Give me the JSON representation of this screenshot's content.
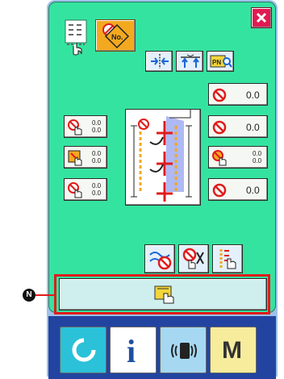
{
  "top": {
    "close_icon": "close-x-icon",
    "pattern_icon": "pattern-list-icon",
    "no_icon_label": "No.",
    "pn_label": "PN"
  },
  "values": {
    "r1": "0.0",
    "r2": "0.0",
    "r3": "0.0",
    "r4": "0.0"
  },
  "left_stacks": {
    "l1": [
      "0.0",
      "0.0"
    ],
    "l2": [
      "0.0",
      "0.0"
    ],
    "l3": [
      "0.0",
      "0.0"
    ],
    "mid3": [
      "0.0",
      "0.0"
    ]
  },
  "callout": {
    "marker": "N"
  },
  "footer": {
    "i_label": "i",
    "m_label": "M"
  },
  "colors": {
    "panel": "#35e3a0",
    "frame": "#9ec1ea",
    "bottom": "#2244a0",
    "accent_red": "#e11b1b",
    "orange": "#f3a91f"
  }
}
